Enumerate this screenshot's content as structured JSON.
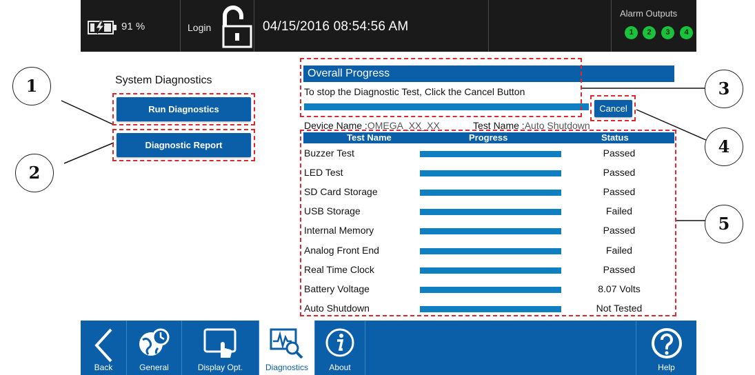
{
  "status_bar": {
    "battery_percent": "91 %",
    "login_label": "Login",
    "datetime": "04/15/2016   08:54:56 AM",
    "alarm_outputs_title": "Alarm Outputs",
    "alarms": [
      "1",
      "2",
      "3",
      "4"
    ],
    "alarm_color": "#19c23a"
  },
  "left_panel": {
    "title": "System Diagnostics",
    "run_button": "Run Diagnostics",
    "report_button": "Diagnostic Report"
  },
  "progress": {
    "header": "Overall Progress",
    "instruction": "To stop the Diagnostic Test, Click the Cancel Button",
    "overall_fill": 1.0,
    "cancel_button": "Cancel",
    "device_name_label": "Device Name :",
    "device_name_value": "OMEGA_XX_XX",
    "test_name_label": "Test Name :",
    "test_name_value": "Auto Shutdown"
  },
  "table": {
    "headers": [
      "Test Name",
      "Progress",
      "Status"
    ],
    "rows": [
      {
        "name": "Buzzer Test",
        "progress": 1.0,
        "status": "Passed"
      },
      {
        "name": "LED Test",
        "progress": 1.0,
        "status": "Passed"
      },
      {
        "name": "SD Card Storage",
        "progress": 1.0,
        "status": "Passed"
      },
      {
        "name": "USB Storage",
        "progress": 1.0,
        "status": "Failed"
      },
      {
        "name": "Internal Memory",
        "progress": 1.0,
        "status": "Passed"
      },
      {
        "name": "Analog Front End",
        "progress": 1.0,
        "status": "Failed"
      },
      {
        "name": "Real Time Clock",
        "progress": 1.0,
        "status": "Passed"
      },
      {
        "name": "Battery Voltage",
        "progress": 1.0,
        "status": "8.07 Volts"
      },
      {
        "name": "Auto Shutdown",
        "progress": 1.0,
        "status": "Not Tested"
      }
    ]
  },
  "callouts": [
    "1",
    "2",
    "3",
    "4",
    "5"
  ],
  "bottom_nav": {
    "back": "Back",
    "general": "General",
    "display_opt": "Display Opt.",
    "diagnostics": "Diagnostics",
    "about": "About",
    "help": "Help",
    "active": "diagnostics"
  },
  "icons": {
    "battery": "battery-charging-icon",
    "login": "unlocked-padlock-icon",
    "back": "chevron-left-icon",
    "general": "globe-clock-icon",
    "display_opt": "touch-screen-icon",
    "diagnostics": "waveform-magnifier-icon",
    "about": "info-icon",
    "help": "question-mark-icon"
  },
  "colors": {
    "brand_blue": "#0a5fa8",
    "progress_blue": "#0e7fc0",
    "annotation_red": "#e0262f",
    "status_bar_bg": "#1a1a1a"
  }
}
